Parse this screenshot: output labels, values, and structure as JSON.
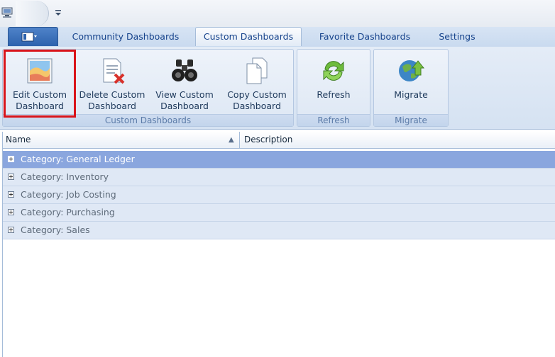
{
  "quick_access": {
    "icons": [
      "computer-icon",
      "application-orb",
      "customize-dropdown-icon"
    ]
  },
  "tabs": [
    {
      "label": "Community Dashboards",
      "active": false
    },
    {
      "label": "Custom Dashboards",
      "active": true
    },
    {
      "label": "Favorite Dashboards",
      "active": false
    },
    {
      "label": "Settings",
      "active": false
    }
  ],
  "ribbon": {
    "groups": [
      {
        "label": "Custom Dashboards"
      },
      {
        "label": "Refresh"
      },
      {
        "label": "Migrate"
      }
    ],
    "buttons": {
      "edit": {
        "label": "Edit Custom\nDashboard",
        "icon": "edit-dashboard-icon",
        "highlighted": true
      },
      "delete": {
        "label": "Delete Custom\nDashboard",
        "icon": "delete-dashboard-icon"
      },
      "view": {
        "label": "View Custom\nDashboard",
        "icon": "binoculars-icon"
      },
      "copy": {
        "label": "Copy Custom\nDashboard",
        "icon": "copy-icon"
      },
      "refresh": {
        "label": "Refresh",
        "icon": "refresh-icon"
      },
      "migrate": {
        "label": "Migrate",
        "icon": "globe-migrate-icon"
      }
    }
  },
  "grid": {
    "columns": [
      {
        "label": "Name",
        "sort": "ascending"
      },
      {
        "label": "Description"
      }
    ],
    "rows": [
      {
        "label": "Category: General Ledger",
        "selected": true
      },
      {
        "label": "Category: Inventory",
        "selected": false
      },
      {
        "label": "Category: Job Costing",
        "selected": false
      },
      {
        "label": "Category: Purchasing",
        "selected": false
      },
      {
        "label": "Category: Sales",
        "selected": false
      }
    ]
  },
  "colors": {
    "highlight_border": "#d9141a",
    "selected_row": "#8aa6de",
    "group_row": "#dfe8f5"
  }
}
